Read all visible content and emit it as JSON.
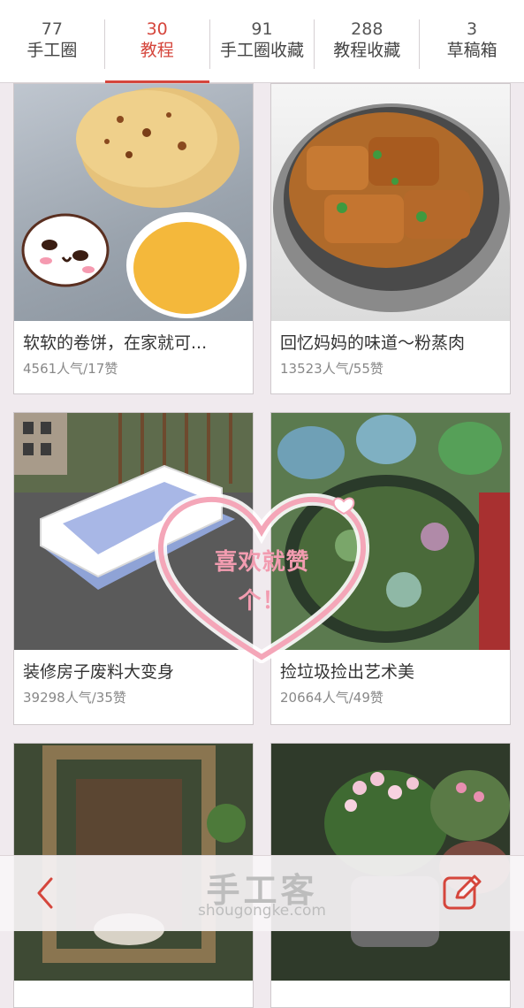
{
  "stats": [
    {
      "count": "77",
      "label": "手工圈",
      "active": false
    },
    {
      "count": "30",
      "label": "教程",
      "active": true
    },
    {
      "count": "91",
      "label": "手工圈收藏",
      "active": false
    },
    {
      "count": "288",
      "label": "教程收藏",
      "active": false
    },
    {
      "count": "3",
      "label": "草稿箱",
      "active": false
    }
  ],
  "cards": [
    {
      "title": "软软的卷饼，在家就可...",
      "meta": "4561人气/17赞"
    },
    {
      "title": "回忆妈妈的味道～粉蒸肉",
      "meta": "13523人气/55赞"
    },
    {
      "title": "装修房子废料大变身",
      "meta": "39298人气/35赞"
    },
    {
      "title": "捡垃圾捡出艺术美",
      "meta": "20664人气/49赞"
    },
    {
      "title": "",
      "meta": ""
    },
    {
      "title": "",
      "meta": ""
    }
  ],
  "like_badge": {
    "line1": "喜欢就赞",
    "line2": "个！"
  },
  "watermark": {
    "brand": "手工客",
    "domain": "shougongke.com"
  },
  "colors": {
    "accent": "#d5463c",
    "badge_pink": "#f29cb0"
  },
  "icons": {
    "back": "chevron-left-icon",
    "edit": "edit-icon"
  }
}
